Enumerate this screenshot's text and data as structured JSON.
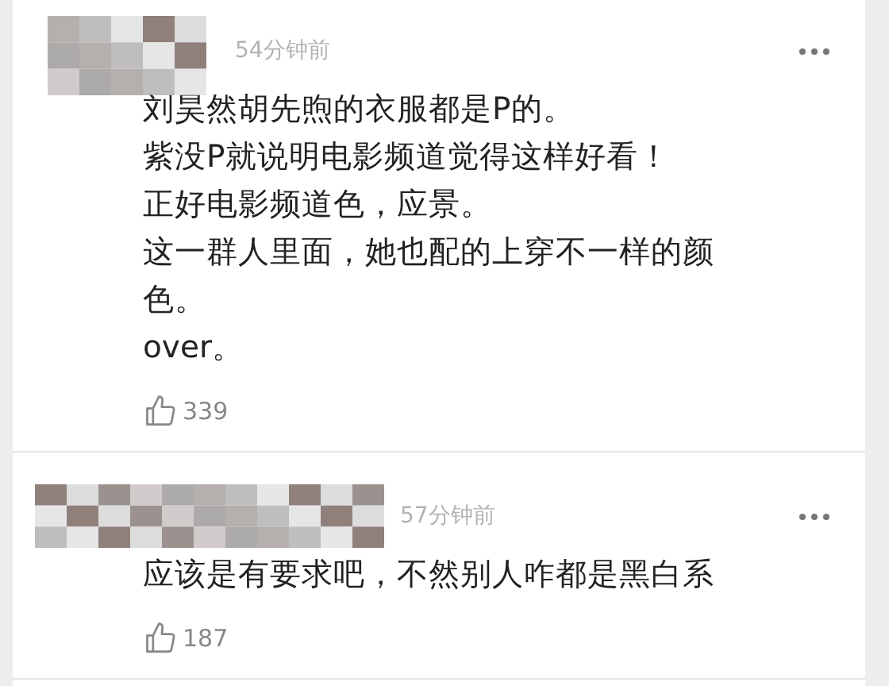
{
  "comments": [
    {
      "time": "54分钟前",
      "lines": [
        "刘昊然胡先煦的衣服都是P的。",
        "紫没P就说明电影频道觉得这样好看！",
        "正好电影频道色，应景。",
        "这一群人里面，她也配的上穿不一样的颜色。",
        "over。"
      ],
      "likes": "339"
    },
    {
      "time": "57分钟前",
      "lines": [
        "应该是有要求吧，不然别人咋都是黑白系"
      ],
      "likes": "187"
    }
  ]
}
